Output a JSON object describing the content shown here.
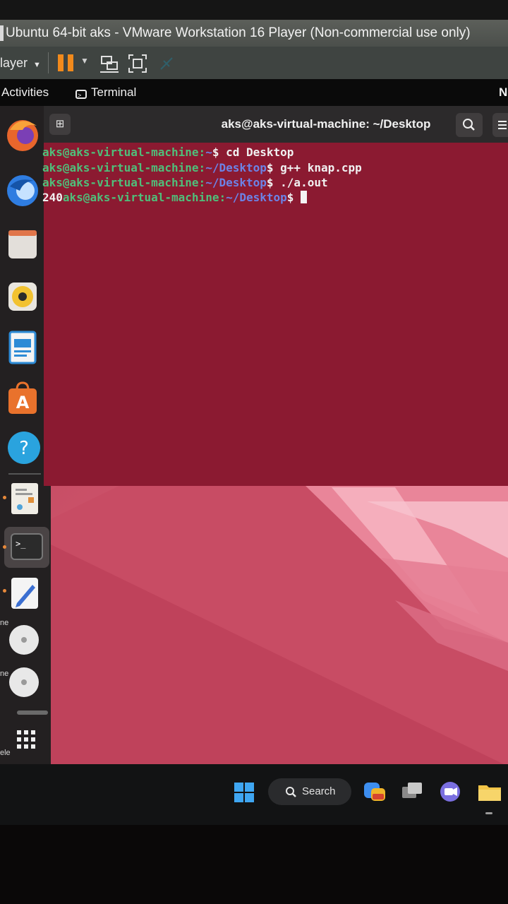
{
  "vmware": {
    "title": "Ubuntu 64-bit aks - VMware Workstation 16 Player (Non-commercial use only)",
    "player_menu": "layer"
  },
  "ubuntu_topbar": {
    "activities": "Activities",
    "app_name": "Terminal",
    "right_edge_text": "N"
  },
  "terminal": {
    "title": "aks@aks-virtual-machine: ~/Desktop",
    "lines": [
      {
        "user": "aks@aks-virtual-machine:",
        "path": "~",
        "sym": "$",
        "cmd": " cd Desktop"
      },
      {
        "user": "aks@aks-virtual-machine:",
        "path": "~/Desktop",
        "sym": "$",
        "cmd": " g++ knap.cpp"
      },
      {
        "user": "aks@aks-virtual-machine:",
        "path": "~/Desktop",
        "sym": "$",
        "cmd": " ./a.out"
      },
      {
        "output": "240",
        "user": "aks@aks-virtual-machine:",
        "path": "~/Desktop",
        "sym": "$",
        "cmd": " "
      }
    ]
  },
  "host_side_text": [
    "ne",
    "ne",
    "ele"
  ],
  "win_taskbar": {
    "search_label": "Search"
  },
  "colors": {
    "terminal_bg": "#8b1a31",
    "prompt_user": "#4fbf7a",
    "prompt_path": "#6c83e6",
    "wallpaper": "#c84c64",
    "pause_accent": "#f28a1c"
  }
}
